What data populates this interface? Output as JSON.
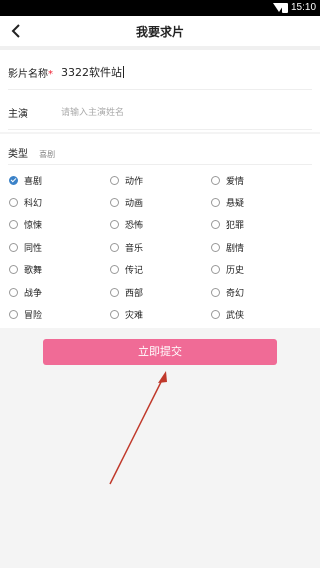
{
  "status": {
    "time": "15:10"
  },
  "nav": {
    "title": "我要求片",
    "back_icon": "chevron-left-icon"
  },
  "form": {
    "film_name": {
      "label": "影片名称",
      "required_mark": "*",
      "value": "3322软件站"
    },
    "actor": {
      "label": "主演",
      "placeholder": "请输入主演姓名"
    }
  },
  "types": {
    "label": "类型",
    "selected": "喜剧",
    "options": [
      "喜剧",
      "动作",
      "爱情",
      "科幻",
      "动画",
      "悬疑",
      "惊悚",
      "恐怖",
      "犯罪",
      "同性",
      "音乐",
      "剧情",
      "歌舞",
      "传记",
      "历史",
      "战争",
      "西部",
      "奇幻",
      "冒险",
      "灾难",
      "武侠"
    ]
  },
  "submit_label": "立即提交",
  "colors": {
    "submit": "#f06b96",
    "checked": "#3b82c8",
    "required": "#e23333",
    "arrow": "#c0392b"
  }
}
